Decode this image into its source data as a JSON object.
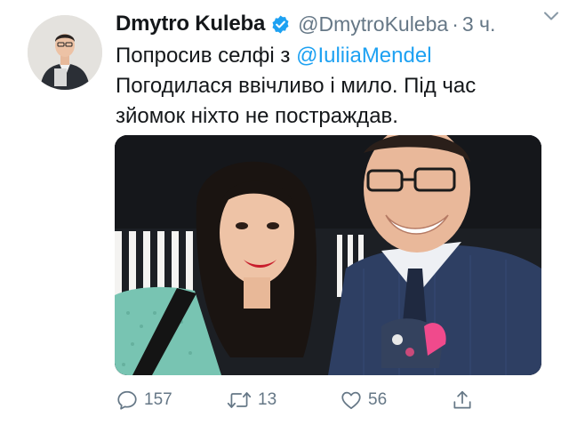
{
  "tweet": {
    "author": {
      "display_name": "Dmytro Kuleba",
      "handle": "@DmytroKuleba",
      "verified": true,
      "avatar": "profile-photo"
    },
    "separator": "·",
    "time": "3 ч.",
    "text_lines": [
      {
        "before": "Попросив селфі з ",
        "mention": "@IuliiaMendel"
      },
      {
        "text": "Погодилася ввічливо і мило. Під час"
      },
      {
        "text": "зйомок ніхто не постраждав."
      }
    ],
    "media": {
      "type": "photo",
      "icon": "selfie-photo"
    },
    "actions": {
      "reply": {
        "icon": "reply-icon",
        "count": "157"
      },
      "retweet": {
        "icon": "retweet-icon",
        "count": "13"
      },
      "like": {
        "icon": "heart-icon",
        "count": "56"
      },
      "share": {
        "icon": "share-icon"
      }
    },
    "colors": {
      "text": "#14171a",
      "secondary": "#657786",
      "link": "#1da1f2",
      "verified": "#1da1f2"
    }
  }
}
